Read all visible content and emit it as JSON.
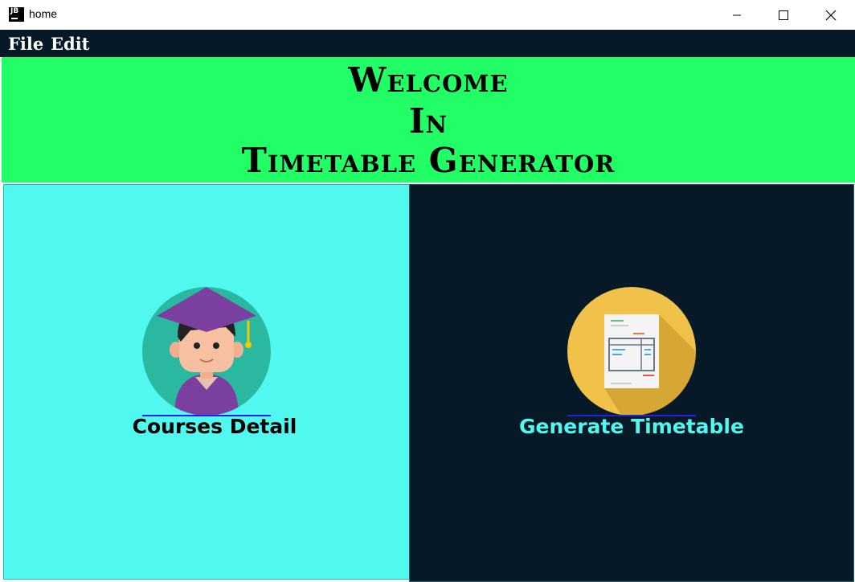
{
  "window": {
    "title": "home",
    "app_icon_text": "JB"
  },
  "menu": {
    "file": "File",
    "edit": "Edit"
  },
  "banner": {
    "line1": "Welcome",
    "line2": "In",
    "line3": "Timetable Generator"
  },
  "cards": {
    "courses": {
      "label": "Courses Detail",
      "icon": "graduate-student-icon"
    },
    "timetable": {
      "label": "Generate Timetable",
      "icon": "timetable-document-icon"
    }
  },
  "colors": {
    "menubar": "#071826",
    "banner": "#22ff66",
    "left_panel": "#50f8f0",
    "right_panel": "#071826",
    "timetable_label": "#50f8f0",
    "underline": "#2222dd"
  }
}
